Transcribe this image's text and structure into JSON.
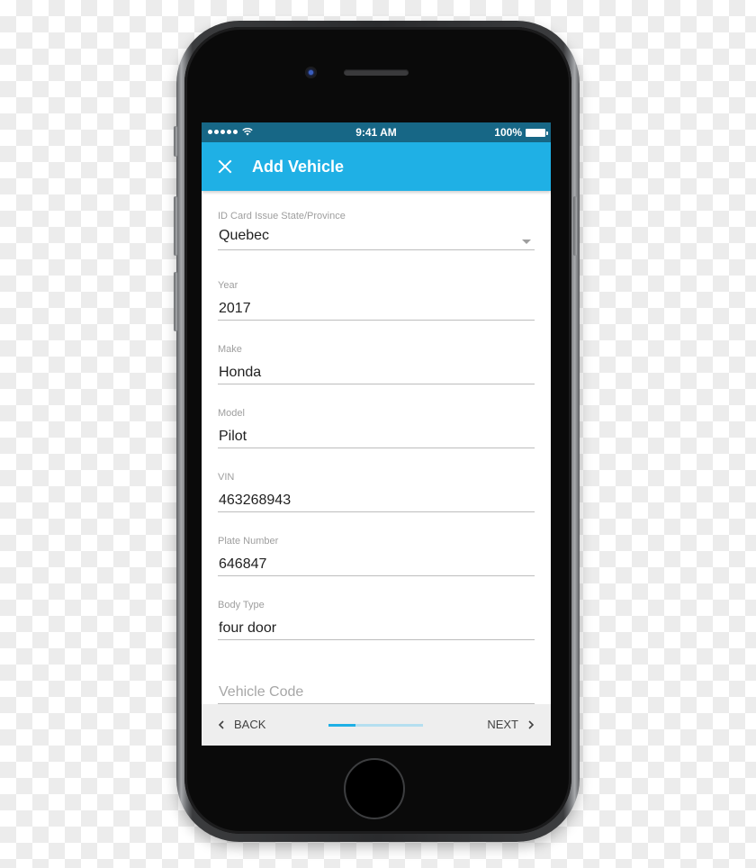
{
  "status_bar": {
    "time": "9:41 AM",
    "battery": "100%",
    "signal_icon": "signal-dots-icon",
    "wifi_icon": "wifi-icon",
    "battery_icon": "battery-icon"
  },
  "app_bar": {
    "title": "Add Vehicle",
    "close_icon": "close-icon",
    "color": "#1fb0e5"
  },
  "form": {
    "fields": [
      {
        "label": "ID Card Issue State/Province",
        "value": "Quebec",
        "type": "dropdown"
      },
      {
        "label": "Year",
        "value": "2017"
      },
      {
        "label": "Make",
        "value": "Honda"
      },
      {
        "label": "Model",
        "value": "Pilot"
      },
      {
        "label": "VIN",
        "value": "463268943"
      },
      {
        "label": "Plate Number",
        "value": "646847"
      },
      {
        "label": "Body Type",
        "value": "four door"
      },
      {
        "label": "",
        "value": "",
        "placeholder": "Vehicle Code"
      }
    ]
  },
  "bottom_bar": {
    "back_label": "BACK",
    "next_label": "NEXT",
    "progress_fraction": 0.29,
    "progress_color": "#1fb0e5",
    "progress_track_color": "#b5dff0"
  }
}
